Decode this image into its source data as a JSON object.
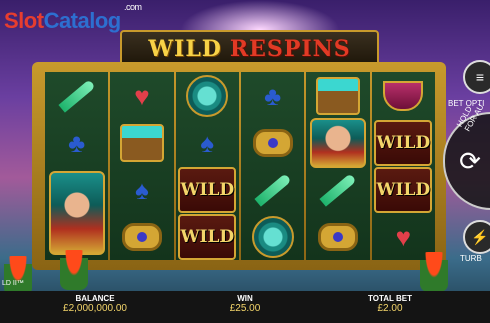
{
  "watermark": {
    "part1": "Slot",
    "part2": "Catalog",
    "suffix": ".com"
  },
  "title": {
    "word1": "WILD",
    "word2": "RESPINS"
  },
  "reels": [
    [
      "dagger",
      "club-red",
      "queen",
      ""
    ],
    [
      "heart",
      "chest",
      "spade",
      "ring"
    ],
    [
      "disc",
      "spade",
      "WILD",
      "WILD"
    ],
    [
      "club",
      "ring",
      "dagger",
      "disc"
    ],
    [
      "chest",
      "queen",
      "dagger",
      "ring"
    ],
    [
      "bowl",
      "WILD",
      "WILD",
      "heart"
    ]
  ],
  "side_panel": {
    "bet_options_label": "BET OPTI",
    "autoplay_label": "HOLD FOR AU",
    "turbo_label": "TURB"
  },
  "game_name_fragment": "LD II™",
  "footer": {
    "balance_label": "BALANCE",
    "balance_value": "£2,000,000.00",
    "win_label": "WIN",
    "win_value": "£25.00",
    "total_bet_label": "TOTAL BET",
    "total_bet_value": "£2.00"
  },
  "colors": {
    "gold": "#c89a2c",
    "reel_bg": "#1f4a2a",
    "wild_text": "#f3d56a"
  }
}
